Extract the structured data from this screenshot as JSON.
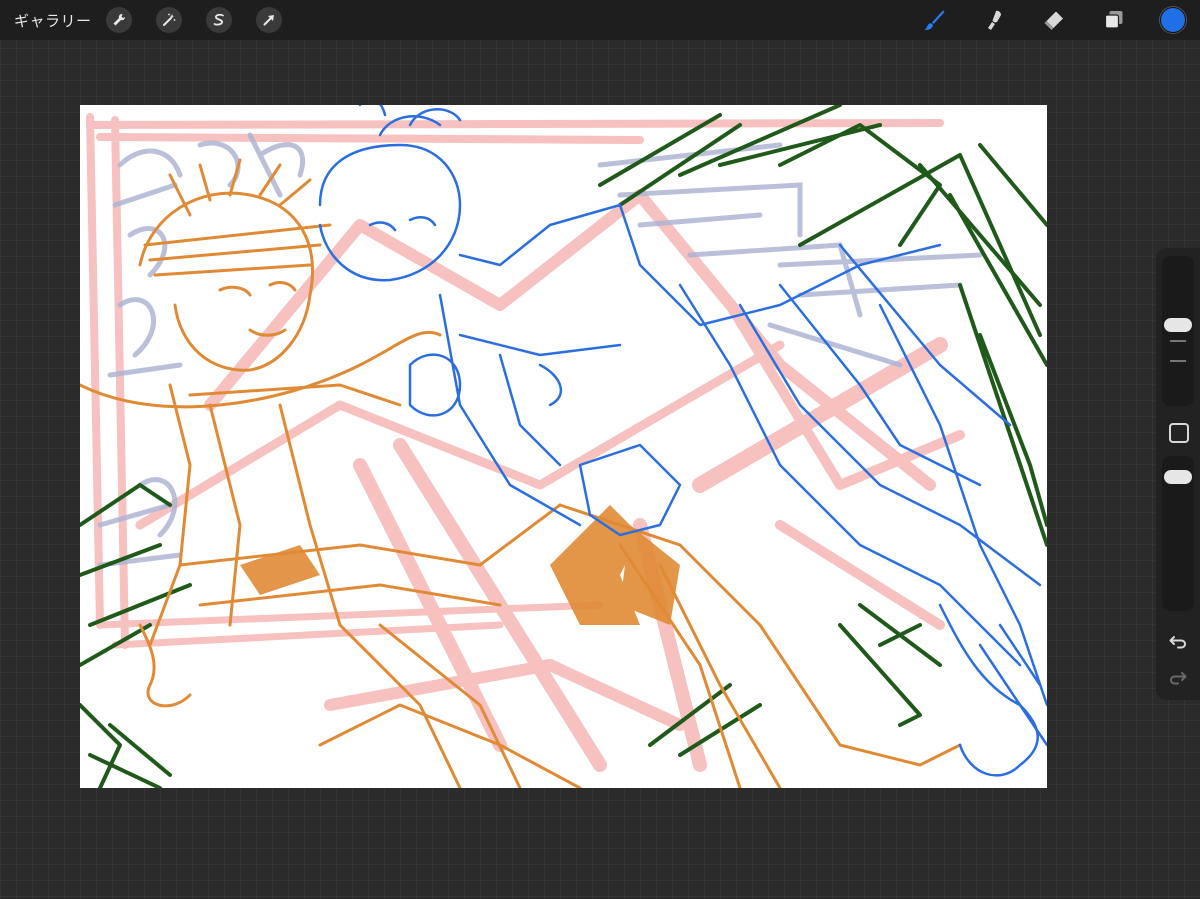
{
  "topbar": {
    "gallery_label": "ギャラリー",
    "left_icons": [
      "wrench-icon",
      "magic-wand-icon",
      "selection-s-icon",
      "transform-arrow-icon"
    ],
    "right_icons": [
      "brush-icon",
      "smudge-icon",
      "eraser-icon",
      "layers-icon"
    ],
    "current_color": "#1f6fe6"
  },
  "canvas": {
    "background": "#ffffff",
    "layer_colors": {
      "pink": "#f4b2b0",
      "lavender": "#aeb4d4",
      "orange": "#e08a35",
      "blue": "#2a6ee0",
      "green": "#1f5a1a"
    }
  },
  "sidebar": {
    "brush_size_level": 0.3,
    "opacity_level": 0.2,
    "icons": [
      "modify-square-icon",
      "undo-icon",
      "redo-icon"
    ]
  }
}
